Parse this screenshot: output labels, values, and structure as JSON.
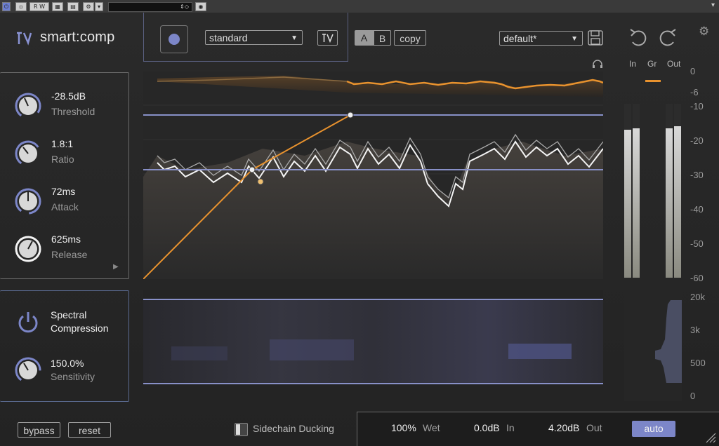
{
  "host": {
    "buttons": [
      "R",
      "W"
    ]
  },
  "header": {
    "app_name": "smart:comp",
    "mode_select": "standard",
    "ab_a": "A",
    "ab_b": "B",
    "copy_label": "copy",
    "preset_select": "default*",
    "colors": {
      "accent": "#7c86c8",
      "orange": "#e8922e"
    }
  },
  "params": [
    {
      "value": "-28.5dB",
      "label": "Threshold",
      "level": 0.35
    },
    {
      "value": "1.8:1",
      "label": "Ratio",
      "level": 0.25
    },
    {
      "value": "72ms",
      "label": "Attack",
      "level": 0.5
    },
    {
      "value": "625ms",
      "label": "Release",
      "level": 0.6
    }
  ],
  "spectral": {
    "title_line1": "Spectral",
    "title_line2": "Compression",
    "sensitivity_value": "150.0%",
    "sensitivity_label": "Sensitivity",
    "sensitivity_level": 0.3
  },
  "graph_axis": {
    "db_labels": [
      "0",
      "-6",
      "-10",
      "-20",
      "-30",
      "-40",
      "-50",
      "-60"
    ],
    "freq_labels": [
      "20k",
      "3k",
      "500",
      "0"
    ]
  },
  "meters": {
    "labels": [
      "In",
      "Gr",
      "Out"
    ],
    "in_levels": [
      0.85,
      0.86
    ],
    "out_levels": [
      0.86,
      0.87
    ]
  },
  "bottom": {
    "bypass_label": "bypass",
    "reset_label": "reset",
    "sidechain_label": "Sidechain Ducking",
    "wet_value": "100%",
    "wet_label": "Wet",
    "in_value": "0.0dB",
    "in_label": "In",
    "out_value": "4.20dB",
    "out_label": "Out",
    "auto_label": "auto"
  }
}
